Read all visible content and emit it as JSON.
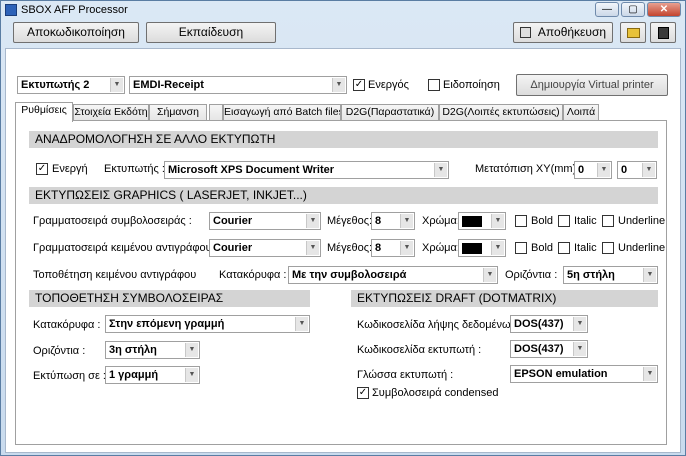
{
  "window": {
    "title": "SBOX AFP Processor",
    "min": "—",
    "max": "▢",
    "close": "✕"
  },
  "toolbar": {
    "decode": "Αποκωδικοποίηση",
    "train": "Εκπαίδευση",
    "save": "Αποθήκευση"
  },
  "printer": {
    "selected": "Εκτυπωτής 2",
    "name": "EMDI-Receipt",
    "active_label": "Ενεργός",
    "notify_label": "Ειδοποίηση",
    "create_virtual": "Δημιουργία Virtual printer"
  },
  "tabs": [
    "Ρυθμίσεις",
    "Στοιχεία Εκδότη",
    "Σήμανση",
    "",
    "Εισαγωγή από Batch files",
    "D2G(Παραστατικά)",
    "D2G(Λοιπές εκτυπώσεις)",
    "Λοιπά"
  ],
  "redirect": {
    "heading": "ΑΝΑΔΡΟΜΟΛΟΓΗΣΗ ΣΕ ΑΛΛΟ ΕΚΤΥΠΩΤΗ",
    "active_label": "Ενεργή",
    "printer_label": "Εκτυπωτής :",
    "printer_value": "Microsoft XPS Document Writer",
    "offset_label": "Μετατόπιση XY(mm) :",
    "offset_x": "0",
    "offset_y": "0"
  },
  "graphics": {
    "heading": "ΕΚΤΥΠΩΣΕΙΣ GRAPHICS ( LASERJET, INKJET...)",
    "symbol_font_label": "Γραμματοσειρά συμβολοσειράς :",
    "copy_font_label": "Γραμματοσειρά κειμένου αντιγράφου :",
    "font_value": "Courier",
    "size_label": "Μέγεθος:",
    "size_value": "8",
    "color_label": "Χρώμα:",
    "bold": "Bold",
    "italic": "Italic",
    "underline": "Underline",
    "placement_label": "Τοποθέτηση κειμένου αντιγράφου",
    "vertical_label": "Κατακόρυφα :",
    "vertical_value": "Με την συμβολοσειρά",
    "horizontal_label": "Οριζόντια :",
    "horizontal_value": "5η στήλη",
    "color_value": "#000000"
  },
  "symbol_pos": {
    "heading": "ΤΟΠΟΘΕΤΗΣΗ ΣΥΜΒΟΛΟΣΕΙΡΑΣ",
    "vertical_label": "Κατακόρυφα :",
    "vertical_value": "Στην επόμενη γραμμή",
    "horizontal_label": "Οριζόντια :",
    "horizontal_value": "3η στήλη",
    "print_in_label": "Εκτύπωση σε :",
    "print_in_value": "1 γραμμή"
  },
  "draft": {
    "heading": "ΕΚΤΥΠΩΣΕΙΣ DRAFT (DOTMATRIX)",
    "codepage_in_label": "Κωδικοσελίδα λήψης δεδομένων :",
    "codepage_in_value": "DOS(437)",
    "codepage_printer_label": "Κωδικοσελίδα εκτυπωτή :",
    "codepage_printer_value": "DOS(437)",
    "language_label": "Γλώσσα εκτυπωτή :",
    "language_value": "EPSON emulation",
    "condensed_label": "Συμβολοσειρά condensed"
  }
}
